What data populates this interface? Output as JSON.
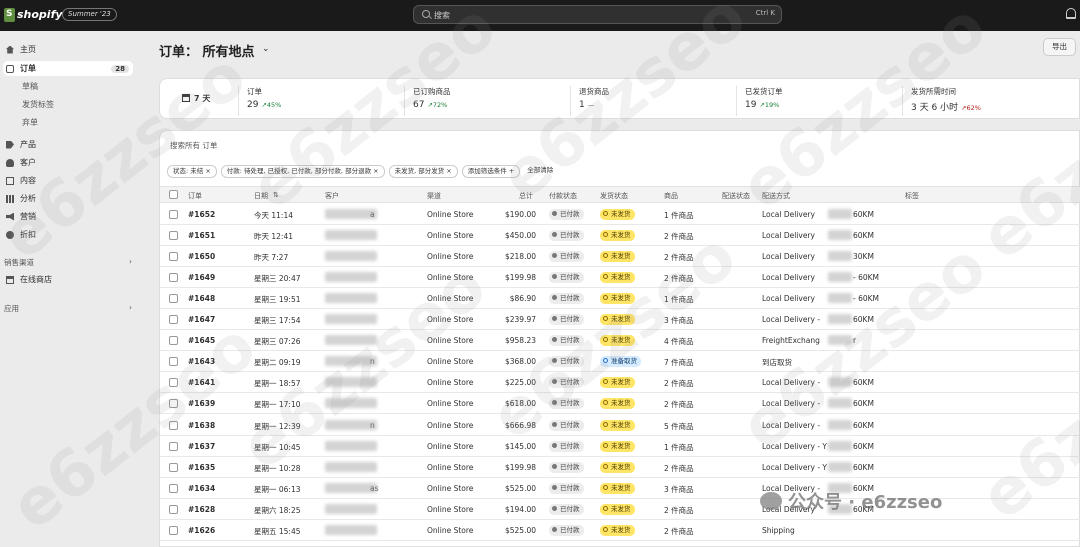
{
  "topbar": {
    "brand": "shopify",
    "edition": "Summer '23",
    "search_placeholder": "搜索",
    "search_shortcut": "Ctrl K"
  },
  "sidebar": {
    "items": [
      {
        "label": "主页",
        "icon": "home-icon"
      },
      {
        "label": "订单",
        "icon": "orders-icon",
        "badge": "28",
        "active": true
      },
      {
        "label": "草稿",
        "sub": true
      },
      {
        "label": "发货标签",
        "sub": true
      },
      {
        "label": "弃单",
        "sub": true
      },
      {
        "label": "产品",
        "icon": "tag-icon"
      },
      {
        "label": "客户",
        "icon": "person-icon"
      },
      {
        "label": "内容",
        "icon": "content-icon"
      },
      {
        "label": "分析",
        "icon": "chart-icon"
      },
      {
        "label": "营销",
        "icon": "megaphone-icon"
      },
      {
        "label": "折扣",
        "icon": "discount-icon"
      }
    ],
    "sales_channels": "销售渠道",
    "online_store": "在线商店",
    "apps": "应用"
  },
  "header": {
    "title": "订单：  所有地点",
    "export": "导出"
  },
  "stats": {
    "range": "7 天",
    "cards": [
      {
        "label": "订单",
        "value": "29",
        "trend": "↗45%"
      },
      {
        "label": "已订购商品",
        "value": "67",
        "trend": "↗72%"
      },
      {
        "label": "退货商品",
        "value": "1",
        "trend": "—"
      },
      {
        "label": "已发货订单",
        "value": "19",
        "trend": "↗19%"
      },
      {
        "label": "发货所需时间",
        "value": "3 天 6 小时",
        "trend": "↗62%"
      }
    ]
  },
  "table": {
    "search": "搜索所有 订单",
    "filters": [
      "状态: 未结 ×",
      "付款: 待处理, 已授权, 已付款, 部分付款, 部分退款 ×",
      "未发货, 部分发货 ×",
      "添加筛选条件 +",
      "全部清除"
    ],
    "headers": [
      "订单",
      "日期",
      "客户",
      "渠道",
      "总计",
      "付款状态",
      "发货状态",
      "商品",
      "配送状态",
      "配送方式",
      "标签"
    ],
    "rows": [
      {
        "order": "#1652",
        "date": "今天 11:14",
        "customer": "a",
        "channel": "Online Store",
        "total": "$190.00",
        "payment": "已付款",
        "fulfill": "未发货",
        "items": "1 件商品",
        "method": "Local Delivery",
        "method_tail": "60KM"
      },
      {
        "order": "#1651",
        "date": "昨天 12:41",
        "customer": "",
        "channel": "Online Store",
        "total": "$450.00",
        "payment": "已付款",
        "fulfill": "未发货",
        "items": "2 件商品",
        "method": "Local Delivery",
        "method_tail": "60KM"
      },
      {
        "order": "#1650",
        "date": "昨天 7:27",
        "customer": "",
        "channel": "Online Store",
        "total": "$218.00",
        "payment": "已付款",
        "fulfill": "未发货",
        "items": "2 件商品",
        "method": "Local Delivery",
        "method_tail": "30KM"
      },
      {
        "order": "#1649",
        "date": "星期三 20:47",
        "customer": "",
        "channel": "Online Store",
        "total": "$199.98",
        "payment": "已付款",
        "fulfill": "未发货",
        "items": "2 件商品",
        "method": "Local Delivery",
        "method_tail": "- 60KM"
      },
      {
        "order": "#1648",
        "date": "星期三 19:51",
        "customer": "",
        "channel": "Online Store",
        "total": "$86.90",
        "payment": "已付款",
        "fulfill": "未发货",
        "items": "1 件商品",
        "method": "Local Delivery",
        "method_tail": "- 60KM"
      },
      {
        "order": "#1647",
        "date": "星期三 17:54",
        "customer": "",
        "channel": "Online Store",
        "total": "$239.97",
        "payment": "已付款",
        "fulfill": "未发货",
        "items": "3 件商品",
        "method": "Local Delivery -",
        "method_tail": "60KM"
      },
      {
        "order": "#1645",
        "date": "星期三 07:26",
        "customer": "",
        "channel": "Online Store",
        "total": "$958.23",
        "payment": "已付款",
        "fulfill": "未发货",
        "items": "4 件商品",
        "method": "FreightExchang",
        "method_tail": "r"
      },
      {
        "order": "#1643",
        "date": "星期二 09:19",
        "customer": "n",
        "channel": "Online Store",
        "total": "$368.00",
        "payment": "已付款",
        "fulfill": "准备取货",
        "items": "7 件商品",
        "method": "到店取货",
        "method_tail": ""
      },
      {
        "order": "#1641",
        "date": "星期一 18:57",
        "customer": "",
        "channel": "Online Store",
        "total": "$225.00",
        "payment": "已付款",
        "fulfill": "未发货",
        "items": "2 件商品",
        "method": "Local Delivery -",
        "method_tail": "60KM"
      },
      {
        "order": "#1639",
        "date": "星期一 17:10",
        "customer": "",
        "channel": "Online Store",
        "total": "$618.00",
        "payment": "已付款",
        "fulfill": "未发货",
        "items": "2 件商品",
        "method": "Local Delivery -",
        "method_tail": "60KM"
      },
      {
        "order": "#1638",
        "date": "星期一 12:39",
        "customer": "n",
        "channel": "Online Store",
        "total": "$666.98",
        "payment": "已付款",
        "fulfill": "未发货",
        "items": "5 件商品",
        "method": "Local Delivery -",
        "method_tail": "60KM"
      },
      {
        "order": "#1637",
        "date": "星期一 10:45",
        "customer": "",
        "channel": "Online Store",
        "total": "$145.00",
        "payment": "已付款",
        "fulfill": "未发货",
        "items": "1 件商品",
        "method": "Local Delivery - Y",
        "method_tail": "60KM"
      },
      {
        "order": "#1635",
        "date": "星期一 10:28",
        "customer": "",
        "channel": "Online Store",
        "total": "$199.98",
        "payment": "已付款",
        "fulfill": "未发货",
        "items": "2 件商品",
        "method": "Local Delivery - Y",
        "method_tail": "60KM"
      },
      {
        "order": "#1634",
        "date": "星期一 06:13",
        "customer": "as",
        "channel": "Online Store",
        "total": "$525.00",
        "payment": "已付款",
        "fulfill": "未发货",
        "items": "3 件商品",
        "method": "Local Delivery -",
        "method_tail": "60KM"
      },
      {
        "order": "#1628",
        "date": "星期六 18:25",
        "customer": "",
        "channel": "Online Store",
        "total": "$194.00",
        "payment": "已付款",
        "fulfill": "未发货",
        "items": "2 件商品",
        "method": "Local Delivery",
        "method_tail": "60KM"
      },
      {
        "order": "#1626",
        "date": "星期五 15:45",
        "customer": "",
        "channel": "Online Store",
        "total": "$525.00",
        "payment": "已付款",
        "fulfill": "未发货",
        "items": "2 件商品",
        "method": "Shipping",
        "method_tail": ""
      }
    ]
  },
  "watermark": {
    "text": "e6zzseo",
    "wechat": "公众号 · e6zzseo"
  }
}
